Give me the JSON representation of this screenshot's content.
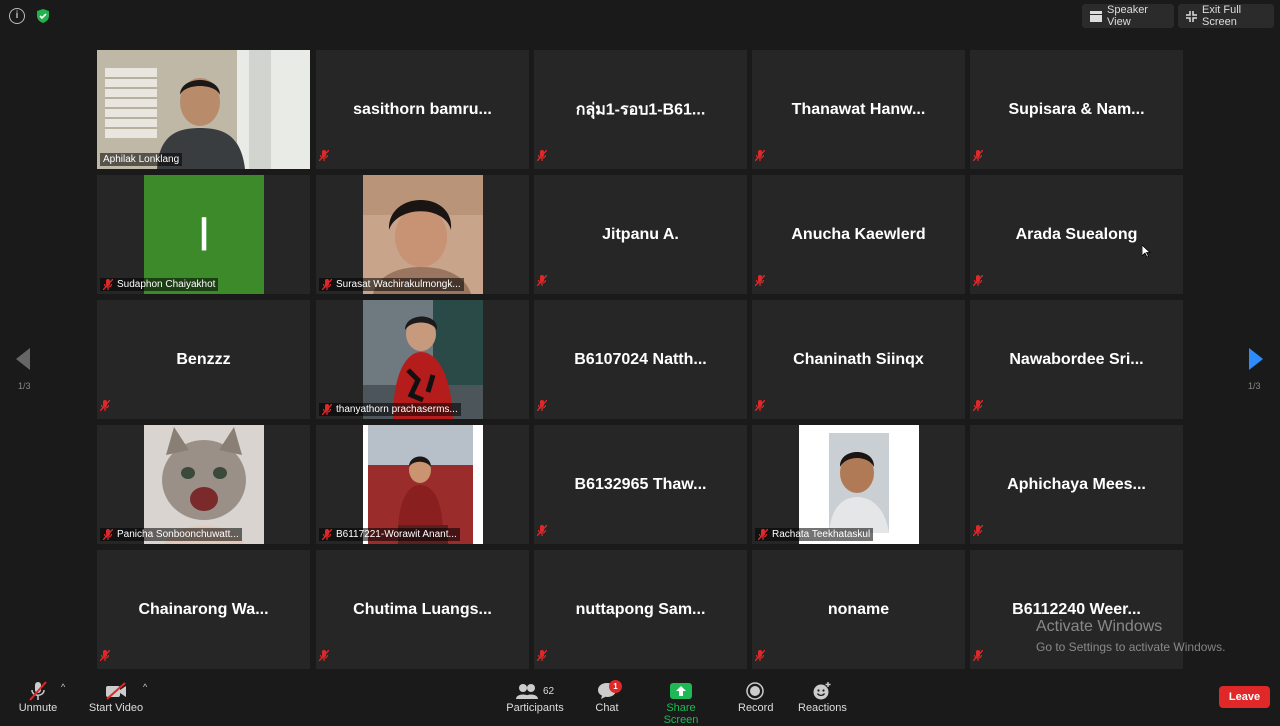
{
  "topbar": {
    "speaker_view": "Speaker View",
    "exit_full_screen": "Exit Full Screen"
  },
  "pager": {
    "left": "1/3",
    "right": "1/3"
  },
  "tiles": [
    {
      "name": "Aphilak Lonklang",
      "video": true,
      "active": true
    },
    {
      "name": "sasithorn  bamru..."
    },
    {
      "name": "กลุ่ม1-รอบ1-B61..."
    },
    {
      "name": "Thanawat  Hanw..."
    },
    {
      "name": "Supisara & Nam..."
    },
    {
      "name": "Sudaphon Chaiyakhot",
      "video": true,
      "avatar_letter": "I"
    },
    {
      "name": "Surasat Wachirakulmongk...",
      "video": true
    },
    {
      "name": "Jitpanu A."
    },
    {
      "name": "Anucha Kaewlerd"
    },
    {
      "name": "Arada Suealong"
    },
    {
      "name": "Benzzz"
    },
    {
      "name": "thanyathorn prachaserms...",
      "video": true
    },
    {
      "name": "B6107024  Natth..."
    },
    {
      "name": "Chaninath Siinqx"
    },
    {
      "name": "Nawabordee  Sri..."
    },
    {
      "name": "Panicha Sonboonchuwatt...",
      "video": true
    },
    {
      "name": "B6117221-Worawit Anant...",
      "video": true
    },
    {
      "name": "B6132965  Thaw..."
    },
    {
      "name": "Rachata Teekhataskul",
      "video": true
    },
    {
      "name": "Aphichaya  Mees..."
    },
    {
      "name": "Chainarong  Wa..."
    },
    {
      "name": "Chutima  Luangs..."
    },
    {
      "name": "nuttapong  Sam..."
    },
    {
      "name": "noname"
    },
    {
      "name": "B6112240  Weer..."
    }
  ],
  "watermark": {
    "title": "Activate Windows",
    "subtitle": "Go to Settings to activate Windows."
  },
  "toolbar": {
    "unmute": "Unmute",
    "start_video": "Start Video",
    "participants": "Participants",
    "participants_count": "62",
    "chat": "Chat",
    "chat_badge": "1",
    "share_screen": "Share Screen",
    "record": "Record",
    "reactions": "Reactions",
    "leave": "Leave"
  },
  "colors": {
    "background": "#1a1a1a",
    "tile": "#262626",
    "active_border": "#e8ec82",
    "share_green": "#1eb955",
    "leave_red": "#e02828",
    "nav_blue": "#2d8cff"
  }
}
